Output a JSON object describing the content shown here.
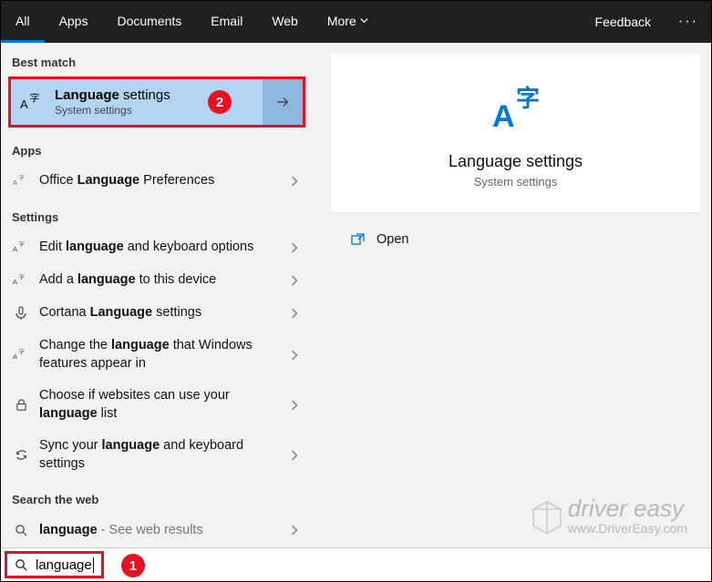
{
  "topbar": {
    "tabs": [
      "All",
      "Apps",
      "Documents",
      "Email",
      "Web",
      "More"
    ],
    "feedback": "Feedback"
  },
  "left": {
    "best_match_label": "Best match",
    "best_match": {
      "title_strong": "Language",
      "title_rest": " settings",
      "subtitle": "System settings"
    },
    "apps_label": "Apps",
    "apps": [
      {
        "pre": "Office ",
        "bold": "Language",
        "post": " Preferences"
      }
    ],
    "settings_label": "Settings",
    "settings": [
      {
        "pre": "Edit ",
        "bold": "language",
        "post": " and keyboard options"
      },
      {
        "pre": "Add a ",
        "bold": "language",
        "post": " to this device"
      },
      {
        "pre": "Cortana ",
        "bold": "Language",
        "post": " settings"
      },
      {
        "pre": "Change the ",
        "bold": "language",
        "post": " that Windows features appear in"
      },
      {
        "pre": "Choose if websites can use your ",
        "bold": "language",
        "post": " list"
      },
      {
        "pre": "Sync your ",
        "bold": "language",
        "post": " and keyboard settings"
      }
    ],
    "web_label": "Search the web",
    "web": [
      {
        "pre": "",
        "bold": "language",
        "dim": " - See web results"
      }
    ]
  },
  "preview": {
    "title": "Language settings",
    "subtitle": "System settings",
    "open": "Open"
  },
  "search": {
    "query": "language"
  },
  "annotations": {
    "step1": "1",
    "step2": "2"
  },
  "watermark": {
    "line1": "driver easy",
    "line2": "www.DriverEasy.com"
  },
  "colors": {
    "accent": "#0078d7",
    "highlight": "#b3d4f3",
    "danger": "#e81123"
  }
}
